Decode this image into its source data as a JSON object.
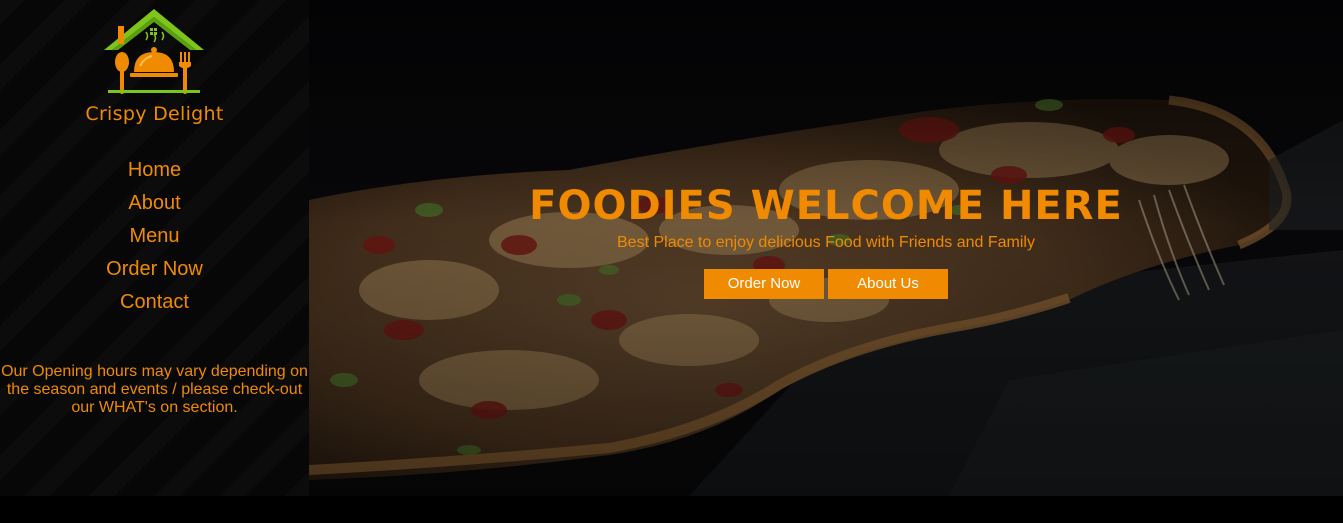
{
  "brand": {
    "name": "Crispy Delight",
    "logo_icon": "restaurant-house-cloche-icon",
    "colors": {
      "roof_green": "#7ec41a",
      "accent_orange": "#f08a00"
    }
  },
  "nav": {
    "items": [
      {
        "label": "Home"
      },
      {
        "label": "About"
      },
      {
        "label": "Menu"
      },
      {
        "label": "Order Now"
      },
      {
        "label": "Contact"
      }
    ]
  },
  "sidebar": {
    "hours_note": "Our Opening hours may vary depending on the season and events / please check-out our WHAT's on section."
  },
  "hero": {
    "title": "FOODIES WELCOME HERE",
    "subtitle": "Best Place to enjoy delicious Food with Friends and Family",
    "buttons": {
      "order_label": "Order Now",
      "about_label": "About Us"
    },
    "background": "pizza-photo"
  },
  "theme": {
    "accent": "#f08a00",
    "background": "#000000",
    "button_text": "#ffffff"
  }
}
